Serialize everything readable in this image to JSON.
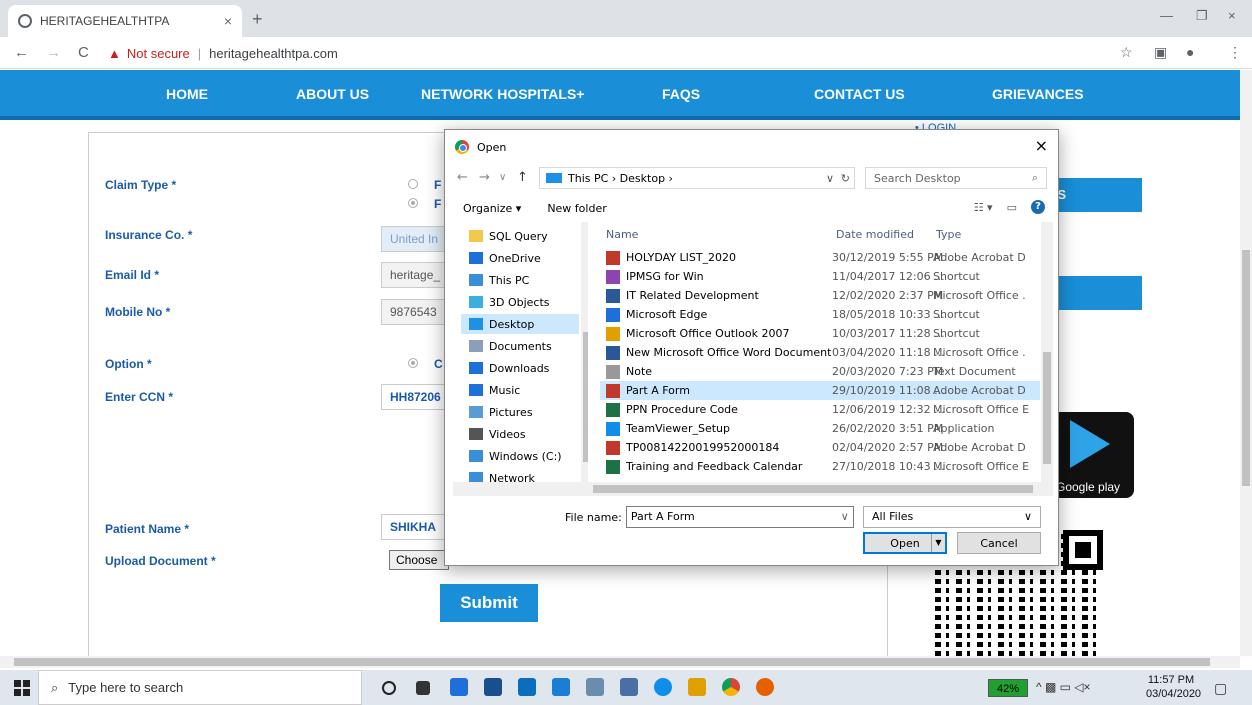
{
  "browser": {
    "tab_title": "HERITAGEHEALTHTPA",
    "tab_close": "×",
    "new_tab": "+",
    "security_text": "Not secure",
    "url": "heritagehealthtpa.com",
    "win_min": "—",
    "win_max": "❐",
    "win_close": "×"
  },
  "nav": {
    "items": [
      "HOME",
      "ABOUT US",
      "NETWORK HOSPITALS+",
      "FAQS",
      "CONTACT US",
      "GRIEVANCES"
    ]
  },
  "login": "• LOGIN",
  "form": {
    "claim_type_label": "Claim Type *",
    "radio_f1": "F",
    "radio_f2": "F",
    "insurance_label": "Insurance Co. *",
    "insurance_value": "United In",
    "email_label": "Email Id *",
    "email_value": "heritage_",
    "mobile_label": "Mobile No *",
    "mobile_value": "9876543",
    "option_label": "Option *",
    "option_radio": "C",
    "ccn_label": "Enter CCN *",
    "ccn_value": "HH87206",
    "patient_label": "Patient Name *",
    "patient_value": "SHIKHA",
    "upload_label": "Upload Document *",
    "choose_label": "Choose",
    "submit_label": "Submit"
  },
  "sidebar": {
    "bar1": "US",
    "bar2": "",
    "gplay_text": "Google play"
  },
  "dialog": {
    "title": "Open",
    "close": "×",
    "path": "This PC › Desktop ›",
    "search_placeholder": "Search Desktop",
    "organize": "Organize ▾",
    "new_folder": "New folder",
    "nav_items": [
      {
        "label": "SQL Query",
        "color": "#f2c94c"
      },
      {
        "label": "OneDrive",
        "color": "#1e6fd9"
      },
      {
        "label": "This PC",
        "color": "#3b8fd9"
      },
      {
        "label": "3D Objects",
        "color": "#3ab0e0"
      },
      {
        "label": "Desktop",
        "color": "#1e90e8"
      },
      {
        "label": "Documents",
        "color": "#8aa0b8"
      },
      {
        "label": "Downloads",
        "color": "#1e6fd9"
      },
      {
        "label": "Music",
        "color": "#1e6fd9"
      },
      {
        "label": "Pictures",
        "color": "#5a9bd5"
      },
      {
        "label": "Videos",
        "color": "#555555"
      },
      {
        "label": "Windows (C:)",
        "color": "#3b8fd9"
      },
      {
        "label": "Network",
        "color": "#3b8fd9"
      }
    ],
    "columns": {
      "name": "Name",
      "date": "Date modified",
      "type": "Type"
    },
    "files": [
      {
        "name": "HOLYDAY LIST_2020",
        "date": "30/12/2019 5:55 PM",
        "type": "Adobe Acrobat D",
        "color": "#c0392b"
      },
      {
        "name": "IPMSG for Win",
        "date": "11/04/2017 12:06 ...",
        "type": "Shortcut",
        "color": "#8e44ad"
      },
      {
        "name": "IT Related Development",
        "date": "12/02/2020 2:37 PM",
        "type": "Microsoft Office .",
        "color": "#2b5797"
      },
      {
        "name": "Microsoft Edge",
        "date": "18/05/2018 10:33 ...",
        "type": "Shortcut",
        "color": "#1e6fd9"
      },
      {
        "name": "Microsoft Office Outlook 2007",
        "date": "10/03/2017 11:28 ...",
        "type": "Shortcut",
        "color": "#e0a000"
      },
      {
        "name": "New Microsoft Office Word Document",
        "date": "03/04/2020 11:18 ...",
        "type": "Microsoft Office .",
        "color": "#2b5797"
      },
      {
        "name": "Note",
        "date": "20/03/2020 7:23 PM",
        "type": "Text Document",
        "color": "#999999"
      },
      {
        "name": "Part A Form",
        "date": "29/10/2019 11:08 ...",
        "type": "Adobe Acrobat D",
        "color": "#c0392b"
      },
      {
        "name": "PPN Procedure Code",
        "date": "12/06/2019 12:32 ...",
        "type": "Microsoft Office E",
        "color": "#1e7145"
      },
      {
        "name": "TeamViewer_Setup",
        "date": "26/02/2020 3:51 PM",
        "type": "Application",
        "color": "#0e8ee9"
      },
      {
        "name": "TP00814220019952000184",
        "date": "02/04/2020 2:57 PM",
        "type": "Adobe Acrobat D",
        "color": "#c0392b"
      },
      {
        "name": "Training and Feedback Calendar",
        "date": "27/10/2018 10:43 ...",
        "type": "Microsoft Office E",
        "color": "#1e7145"
      }
    ],
    "file_name_label": "File name:",
    "file_name_value": "Part A Form",
    "filter": "All Files",
    "open_label": "Open",
    "cancel_label": "Cancel"
  },
  "taskbar": {
    "search": "Type here to search",
    "battery": "42%",
    "time": "11:57 PM",
    "date": "03/04/2020"
  }
}
